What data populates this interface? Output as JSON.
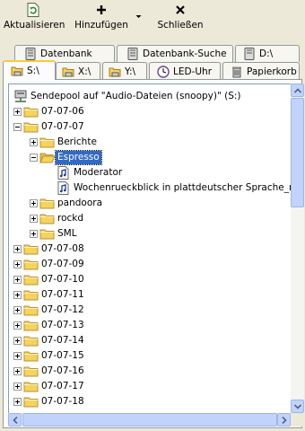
{
  "toolbar": {
    "refresh_label": "Aktualisieren",
    "add_label": "Hinzufügen",
    "close_label": "Schließen"
  },
  "tabs": {
    "row1": [
      {
        "label": "Datenbank",
        "icon": "database-icon"
      },
      {
        "label": "Datenbank-Suche",
        "icon": "database-icon"
      },
      {
        "label": "D:\\",
        "icon": "drive-icon"
      }
    ],
    "row2": [
      {
        "label": "S:\\",
        "icon": "drive-icon",
        "active": true
      },
      {
        "label": "X:\\",
        "icon": "drive-icon"
      },
      {
        "label": "Y:\\",
        "icon": "drive-icon"
      },
      {
        "label": "LED-Uhr",
        "icon": "clock-icon"
      },
      {
        "label": "Papierkorb",
        "icon": "trash-icon"
      }
    ]
  },
  "tree": {
    "root": "Sendepool auf \"Audio-Dateien (snoopy)\" (S:)",
    "items": [
      {
        "label": "07-07-06",
        "level": 1,
        "type": "folder",
        "expander": "plus"
      },
      {
        "label": "07-07-07",
        "level": 1,
        "type": "folder",
        "expander": "minus"
      },
      {
        "label": "Berichte",
        "level": 2,
        "type": "folder",
        "expander": "plus"
      },
      {
        "label": "Espresso",
        "level": 2,
        "type": "folder-open",
        "expander": "minus",
        "selected": true
      },
      {
        "label": "Moderator",
        "level": 3,
        "type": "audio",
        "expander": "none"
      },
      {
        "label": "Wochenrueckblick in plattdeutscher Sprache_rz",
        "level": 3,
        "type": "audio",
        "expander": "none"
      },
      {
        "label": "pandoora",
        "level": 2,
        "type": "folder",
        "expander": "plus"
      },
      {
        "label": "rockd",
        "level": 2,
        "type": "folder",
        "expander": "plus"
      },
      {
        "label": "SML",
        "level": 2,
        "type": "folder",
        "expander": "plus"
      },
      {
        "label": "07-07-08",
        "level": 1,
        "type": "folder",
        "expander": "plus"
      },
      {
        "label": "07-07-09",
        "level": 1,
        "type": "folder",
        "expander": "plus"
      },
      {
        "label": "07-07-10",
        "level": 1,
        "type": "folder",
        "expander": "plus"
      },
      {
        "label": "07-07-11",
        "level": 1,
        "type": "folder",
        "expander": "plus"
      },
      {
        "label": "07-07-12",
        "level": 1,
        "type": "folder",
        "expander": "plus"
      },
      {
        "label": "07-07-13",
        "level": 1,
        "type": "folder",
        "expander": "plus"
      },
      {
        "label": "07-07-14",
        "level": 1,
        "type": "folder",
        "expander": "plus"
      },
      {
        "label": "07-07-15",
        "level": 1,
        "type": "folder",
        "expander": "plus"
      },
      {
        "label": "07-07-16",
        "level": 1,
        "type": "folder",
        "expander": "plus"
      },
      {
        "label": "07-07-17",
        "level": 1,
        "type": "folder",
        "expander": "plus"
      },
      {
        "label": "07-07-18",
        "level": 1,
        "type": "folder",
        "expander": "plus"
      }
    ]
  },
  "colors": {
    "selection": "#316ac5",
    "folder": "#f6d35d",
    "active_tab_accent": "#ffc83c",
    "window_bg": "#ece9d8"
  }
}
